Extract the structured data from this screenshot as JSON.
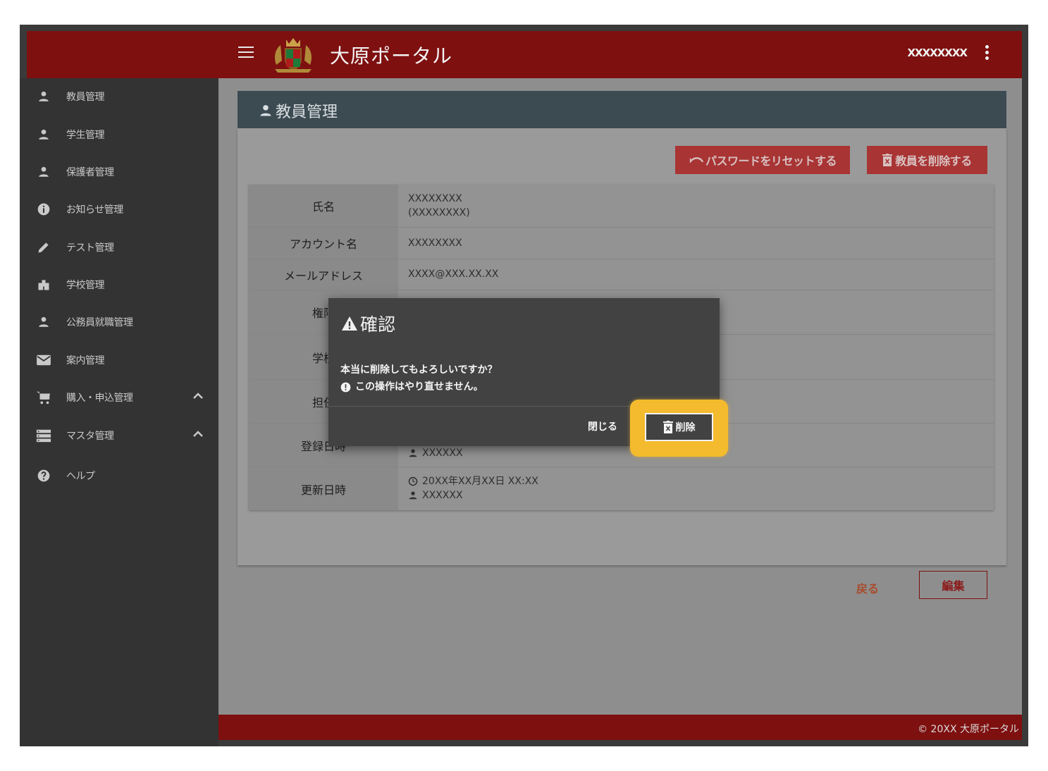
{
  "header": {
    "app_title": "大原ポータル",
    "user_name": "XXXXXXXX"
  },
  "sidebar": {
    "items": [
      {
        "label": "教員管理",
        "icon": "person-icon"
      },
      {
        "label": "学生管理",
        "icon": "person-icon"
      },
      {
        "label": "保護者管理",
        "icon": "person-icon"
      },
      {
        "label": "お知らせ管理",
        "icon": "info-icon"
      },
      {
        "label": "テスト管理",
        "icon": "pencil-icon"
      },
      {
        "label": "学校管理",
        "icon": "school-icon"
      },
      {
        "label": "公務員就職管理",
        "icon": "person-icon"
      },
      {
        "label": "案内管理",
        "icon": "mail-icon"
      },
      {
        "label": "購入・申込管理",
        "icon": "cart-icon"
      },
      {
        "label": "マスタ管理",
        "icon": "list-icon"
      },
      {
        "label": "ヘルプ",
        "icon": "help-icon"
      }
    ]
  },
  "main": {
    "page_title": "教員管理",
    "reset_password_label": "パスワードをリセットする",
    "delete_teacher_label": "教員を削除する",
    "rows": [
      {
        "label": "氏名",
        "lines": [
          "XXXXXXXX",
          "(XXXXXXXX)"
        ]
      },
      {
        "label": "アカウント名",
        "lines": [
          "XXXXXXXX"
        ]
      },
      {
        "label": "メールアドレス",
        "lines": [
          "XXXX@XXX.XX.XX"
        ]
      },
      {
        "label": "権限",
        "lines": []
      },
      {
        "label": "学校",
        "lines": []
      },
      {
        "label": "担任",
        "lines": []
      },
      {
        "label": "登録日時",
        "lines": [
          "XXXXXX"
        ]
      },
      {
        "label": "更新日時",
        "lines": [
          "20XX年XX月XX日 XX:XX",
          "XXXXXX"
        ]
      }
    ],
    "back_label": "戻る",
    "edit_label": "編集"
  },
  "dialog": {
    "title": "確認",
    "message": "本当に削除してもよろしいですか？",
    "warning": "この操作はやり直せません。",
    "close_label": "閉じる",
    "delete_label": "削除"
  },
  "footer": {
    "copyright": "© 20XX 大原ポータル"
  },
  "colors": {
    "brand": "#7e1010",
    "highlight": "#f5bb2e"
  }
}
